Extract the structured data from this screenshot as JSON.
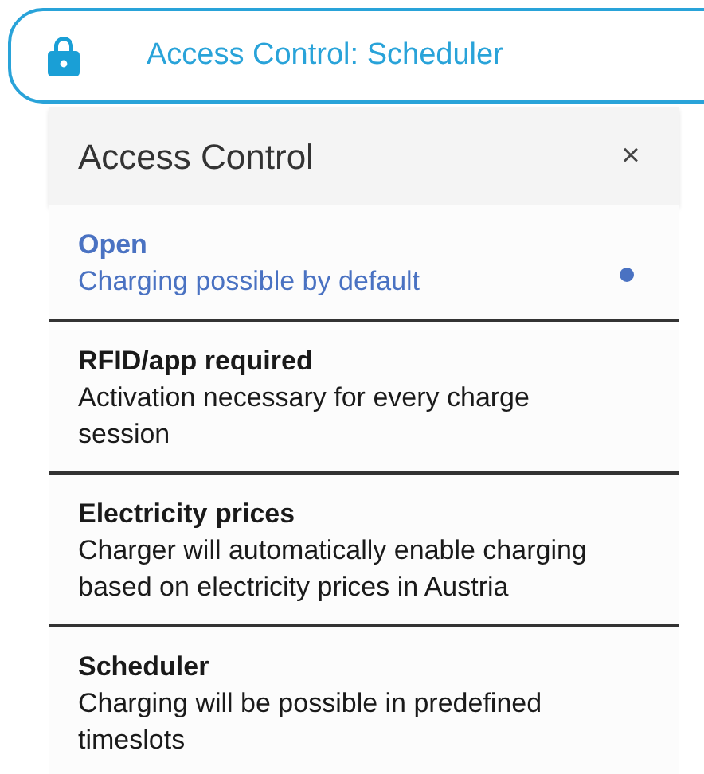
{
  "access_chip": {
    "label": "Access Control: Scheduler"
  },
  "dialog": {
    "title": "Access Control",
    "close": "×",
    "options": [
      {
        "title": "Open",
        "description": "Charging possible by default",
        "selected": true
      },
      {
        "title": "RFID/app required",
        "description": "Activation necessary for every charge session",
        "selected": false
      },
      {
        "title": "Electricity prices",
        "description": "Charger will automatically enable charging based on electricity prices in Austria",
        "selected": false
      },
      {
        "title": "Scheduler",
        "description": "Charging will be possible in predefined timeslots",
        "selected": false
      }
    ]
  }
}
